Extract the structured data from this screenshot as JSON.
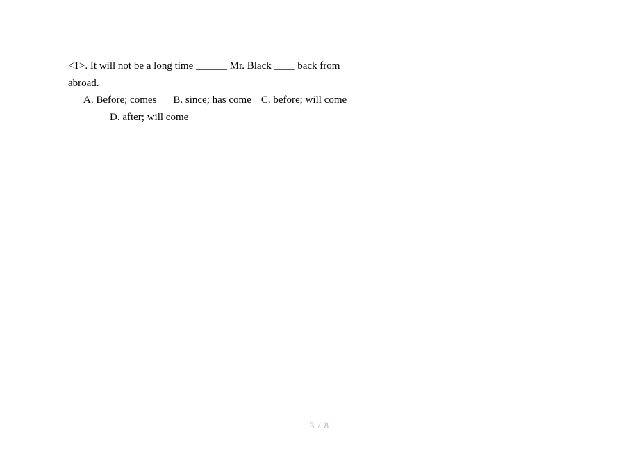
{
  "question": {
    "number": "<1>.",
    "text_part1": "It will not be a long time ______ Mr. Black ____ back from",
    "text_part2": "abroad."
  },
  "options": {
    "a": "A.  Before; comes",
    "b": "B. since; has come",
    "c": "C. before; will come",
    "d": "D. after; will come"
  },
  "footer": {
    "page_current": "3",
    "separator": "/",
    "page_total": "8"
  }
}
